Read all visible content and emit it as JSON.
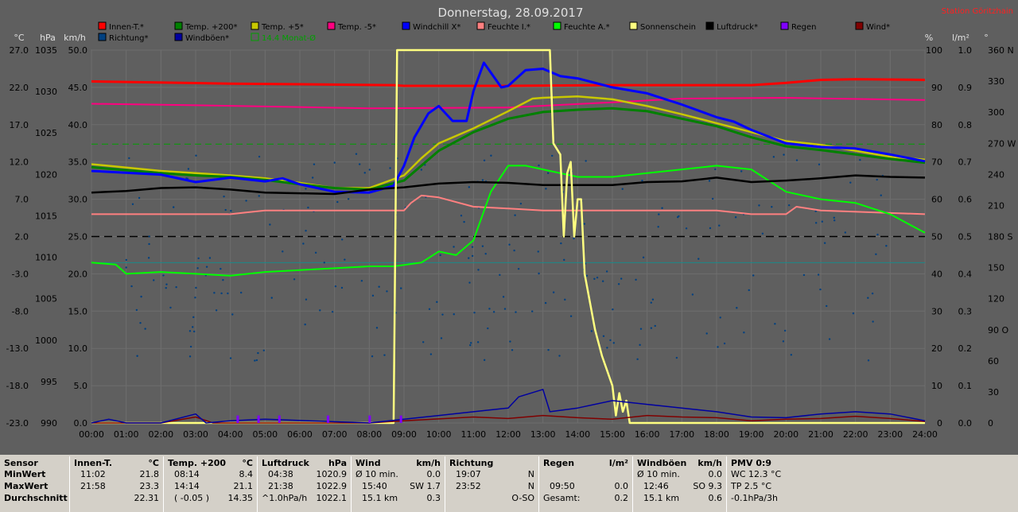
{
  "chart_data": {
    "type": "line",
    "title": "Donnerstag, 28.09.2017",
    "station": "Station Göritzhain",
    "background": "#5f5f5f",
    "grid": true,
    "x": {
      "range": [
        0,
        24
      ],
      "tick_labels": [
        "00:00",
        "01:00",
        "02:00",
        "03:00",
        "04:00",
        "05:00",
        "06:00",
        "07:00",
        "08:00",
        "09:00",
        "10:00",
        "11:00",
        "12:00",
        "13:00",
        "14:00",
        "15:00",
        "16:00",
        "17:00",
        "18:00",
        "19:00",
        "20:00",
        "21:00",
        "22:00",
        "23:00",
        "24:00"
      ]
    },
    "axes": {
      "temp_c": {
        "unit": "°C",
        "range": [
          -23,
          27
        ],
        "ticks": [
          "27.0",
          "22.0",
          "17.0",
          "12.0",
          "7.0",
          "2.0",
          "-3.0",
          "-8.0",
          "-13.0",
          "-18.0",
          "-23.0"
        ]
      },
      "pressure_hpa": {
        "unit": "hPa",
        "range": [
          990,
          1040
        ],
        "ticks": [
          "1035",
          "1030",
          "1025",
          "1020",
          "1015",
          "1010",
          "1005",
          "1000",
          "995",
          "990"
        ]
      },
      "wind_kmh": {
        "unit": "km/h",
        "range": [
          0,
          50
        ],
        "ticks": [
          "50.0",
          "45.0",
          "40.0",
          "35.0",
          "30.0",
          "25.0",
          "20.0",
          "15.0",
          "10.0",
          "5.0",
          "0.0"
        ]
      },
      "humidity_pct": {
        "unit": "%",
        "range": [
          0,
          100
        ],
        "ticks": [
          "100",
          "90",
          "80",
          "70",
          "60",
          "50",
          "40",
          "30",
          "20",
          "10",
          "0"
        ]
      },
      "rain_lm2": {
        "unit": "l/m²",
        "range": [
          0,
          1
        ],
        "ticks": [
          "1.0",
          "0.9",
          "0.8",
          "0.7",
          "0.6",
          "0.5",
          "0.4",
          "0.3",
          "0.2",
          "0.1",
          "0.0"
        ]
      },
      "direction_deg": {
        "unit": "°",
        "range": [
          0,
          360
        ],
        "ticks": [
          "360 N",
          "330",
          "300",
          "270 W",
          "240",
          "210",
          "180 S",
          "150",
          "120",
          "90 O",
          "60",
          "30",
          "0"
        ]
      }
    },
    "legend": [
      {
        "name": "Innen-T.*",
        "color": "#ff0000"
      },
      {
        "name": "Temp. +200*",
        "color": "#008000"
      },
      {
        "name": "Temp. +5*",
        "color": "#c8c800"
      },
      {
        "name": "Temp. -5*",
        "color": "#ff0080"
      },
      {
        "name": "Windchill X*",
        "color": "#0000ff"
      },
      {
        "name": "Feuchte I.*",
        "color": "#ff8080"
      },
      {
        "name": "Feuchte A.*",
        "color": "#00ff00"
      },
      {
        "name": "Sonnenschein",
        "color": "#ffff80"
      },
      {
        "name": "Luftdruck*",
        "color": "#000000"
      },
      {
        "name": "Regen",
        "color": "#8000ff"
      },
      {
        "name": "Wind*",
        "color": "#800000"
      },
      {
        "name": "Richtung*",
        "color": "#004080"
      },
      {
        "name": "Windböen*",
        "color": "#0000a0"
      },
      {
        "name": "14.4 Monat-Ø",
        "color": "#00a000"
      }
    ],
    "series": [
      {
        "name": "Innen-T.*",
        "axis": "temp_c",
        "color": "#ff0000",
        "x": [
          0,
          4,
          8.7,
          9,
          12,
          15,
          19,
          20,
          21,
          22,
          24
        ],
        "y": [
          22.8,
          22.5,
          22.3,
          22.2,
          22.2,
          22.3,
          22.3,
          22.6,
          23.0,
          23.1,
          23.0
        ]
      },
      {
        "name": "Temp. -5*",
        "color": "#ff0080",
        "axis": "temp_c",
        "x": [
          0,
          3,
          8,
          12,
          15,
          17,
          20,
          24
        ],
        "y": [
          19.8,
          19.6,
          19.2,
          19.3,
          20.0,
          20.5,
          20.6,
          20.3
        ]
      },
      {
        "name": "Temp. +5*",
        "color": "#c8c800",
        "axis": "temp_c",
        "x": [
          0,
          2,
          3,
          4,
          5,
          6,
          7,
          8,
          9,
          9.5,
          10,
          11,
          12,
          12.7,
          13,
          14,
          15,
          16,
          17,
          18,
          19,
          20,
          21,
          22,
          23,
          24
        ],
        "y": [
          11.7,
          10.8,
          10.5,
          10.2,
          9.8,
          9.2,
          8.5,
          8.5,
          10.2,
          12.5,
          14.5,
          16.5,
          18.8,
          20.5,
          20.6,
          20.8,
          20.4,
          19.5,
          18.4,
          17.2,
          16.0,
          14.8,
          14.3,
          13.5,
          12.7,
          12.3
        ]
      },
      {
        "name": "Temp. +200*",
        "color": "#008000",
        "axis": "temp_c",
        "x": [
          0,
          2,
          3,
          4,
          5,
          6,
          7,
          8,
          9,
          9.5,
          10,
          11,
          12,
          13,
          14,
          15,
          16,
          17,
          18,
          19,
          20,
          21,
          22,
          23,
          24
        ],
        "y": [
          11.3,
          10.5,
          10.2,
          10.0,
          9.6,
          9.0,
          8.5,
          8.3,
          9.5,
          11.5,
          13.5,
          16.0,
          17.8,
          18.7,
          19.0,
          19.2,
          18.8,
          17.8,
          16.8,
          15.3,
          14.1,
          13.6,
          13.0,
          12.4,
          11.9
        ]
      },
      {
        "name": "Windchill X*",
        "color": "#0000ff",
        "axis": "temp_c",
        "x": [
          0,
          2,
          3,
          4,
          5,
          5.5,
          6,
          7,
          8,
          8.7,
          9,
          9.3,
          9.7,
          10,
          10.4,
          10.8,
          11,
          11.3,
          11.8,
          12,
          12.5,
          13,
          13.5,
          14,
          15,
          16,
          17,
          18,
          18.5,
          19,
          20,
          21,
          22,
          23,
          24
        ],
        "y": [
          10.8,
          10.3,
          9.3,
          9.9,
          9.4,
          9.8,
          9.0,
          8.0,
          7.9,
          8.8,
          11.5,
          15.3,
          18.5,
          19.5,
          17.5,
          17.5,
          21.5,
          25.3,
          22.0,
          22.2,
          24.3,
          24.5,
          23.5,
          23.2,
          22.0,
          21.2,
          19.7,
          18.0,
          17.4,
          16.3,
          14.5,
          14.0,
          13.8,
          13.0,
          12.1
        ]
      },
      {
        "name": "Feuchte I.*",
        "color": "#ff8080",
        "axis": "humidity_pct",
        "x": [
          0,
          4,
          4.5,
          5,
          8,
          9,
          9.2,
          9.5,
          10,
          11,
          12,
          13,
          14,
          18,
          19,
          20,
          20.3,
          21,
          24
        ],
        "y": [
          56,
          56,
          56.5,
          57,
          57,
          57,
          59,
          61,
          60.5,
          58,
          57.5,
          57,
          57,
          57,
          56,
          56,
          58,
          57,
          56
        ]
      },
      {
        "name": "Feuchte A.*",
        "color": "#00ff00",
        "axis": "humidity_pct",
        "x": [
          0,
          0.7,
          1,
          2,
          3,
          4,
          5,
          6,
          7,
          8,
          8.7,
          9.5,
          10,
          10.5,
          11,
          11.5,
          12,
          12.5,
          13,
          14,
          15,
          16,
          17,
          18,
          19,
          20,
          21,
          22,
          23,
          24
        ],
        "y": [
          43,
          42.5,
          40,
          40.5,
          40,
          39.5,
          40.5,
          41,
          41.5,
          42,
          42,
          43,
          46,
          45,
          49,
          62,
          69,
          69,
          68,
          66,
          66,
          67,
          68,
          69,
          68,
          62,
          60,
          59,
          56,
          51
        ]
      },
      {
        "name": "Luftdruck*",
        "color": "#000000",
        "axis": "pressure_hpa",
        "x": [
          0,
          1,
          2,
          3,
          4,
          5,
          6,
          7,
          8,
          9,
          10,
          11,
          12,
          13,
          14,
          15,
          16,
          17,
          18,
          19,
          20,
          21,
          22,
          23,
          24
        ],
        "y": [
          1020.9,
          1021.1,
          1021.5,
          1021.6,
          1021.3,
          1020.9,
          1020.8,
          1020.7,
          1021.3,
          1021.6,
          1022.1,
          1022.3,
          1022.2,
          1021.9,
          1021.9,
          1021.9,
          1022.3,
          1022.4,
          1022.9,
          1022.3,
          1022.5,
          1022.8,
          1023.2,
          1023.0,
          1022.9
        ]
      },
      {
        "name": "Sonnenschein",
        "color": "#ffff80",
        "axis": "humidity_pct",
        "x": [
          0,
          8.7,
          8.75,
          8.8,
          13.2,
          13.3,
          13.5,
          13.6,
          13.7,
          13.8,
          13.9,
          14.0,
          14.1,
          14.2,
          14.5,
          14.7,
          15.0,
          15.1,
          15.2,
          15.3,
          15.4,
          15.5,
          24
        ],
        "y": [
          0,
          0,
          50,
          100,
          100,
          75,
          72,
          50,
          67,
          70,
          50,
          60,
          60,
          40,
          25,
          18,
          10,
          2,
          8,
          3,
          6,
          0,
          0
        ]
      },
      {
        "name": "Wind*",
        "color": "#800000",
        "axis": "wind_kmh",
        "x": [
          0,
          2,
          3,
          3.5,
          8,
          9,
          11,
          12,
          13,
          14,
          15,
          16,
          17,
          18,
          19,
          20,
          21,
          22,
          23,
          24
        ],
        "y": [
          0,
          0,
          0.8,
          0,
          0,
          0.3,
          0.8,
          0.6,
          1.0,
          0.7,
          0.5,
          1.0,
          0.8,
          0.7,
          0.3,
          0.5,
          0.6,
          0.9,
          0.6,
          0.2
        ]
      },
      {
        "name": "Windböen*",
        "color": "#0000a0",
        "axis": "wind_kmh",
        "x": [
          0,
          0.5,
          1,
          2,
          3,
          3.3,
          4,
          5,
          8,
          9,
          10,
          11,
          12,
          12.3,
          13,
          13.2,
          14,
          15,
          16,
          17,
          18,
          19,
          20,
          21,
          22,
          23,
          24
        ],
        "y": [
          0,
          0.5,
          0,
          0,
          1.2,
          0,
          0.3,
          0.5,
          0,
          0.5,
          1.0,
          1.5,
          2.0,
          3.5,
          4.5,
          1.5,
          2.0,
          3.0,
          2.5,
          2.0,
          1.5,
          0.8,
          0.7,
          1.2,
          1.5,
          1.2,
          0.3
        ]
      },
      {
        "name": "Regen",
        "color": "#8000ff",
        "axis": "rain_lm2",
        "x": [
          4.2,
          4.8,
          5.4,
          6.8,
          8.0,
          8.9
        ],
        "y": [
          0.02,
          0.02,
          0.02,
          0.02,
          0.02,
          0.02
        ]
      }
    ],
    "reference_lines": [
      {
        "name": "14.4 Monat-Ø",
        "axis": "temp_c",
        "value": 14.4,
        "color": "#00a000"
      }
    ],
    "direction_scatter": {
      "name": "Richtung*",
      "axis": "direction_deg",
      "color": "#004080",
      "note": "scattered dots"
    }
  },
  "stats": {
    "sensor": {
      "header": "Sensor",
      "rows": [
        "MinWert",
        "MaxWert",
        "Durchschnitt"
      ]
    },
    "innen": {
      "header": "Innen-T.",
      "unit": "°C",
      "rows": [
        [
          "11:02",
          "21.8"
        ],
        [
          "21:58",
          "23.3"
        ],
        [
          "",
          "22.31"
        ]
      ]
    },
    "temp": {
      "header": "Temp. +200",
      "unit": "°C",
      "rows": [
        [
          "08:14",
          "8.4"
        ],
        [
          "14:14",
          "21.1"
        ],
        [
          "( -0.05 )",
          "14.35"
        ]
      ]
    },
    "druck": {
      "header": "Luftdruck",
      "unit": "hPa",
      "rows": [
        [
          "04:38",
          "1020.9"
        ],
        [
          "21:38",
          "1022.9"
        ],
        [
          "^1.0hPa/h",
          "1022.1"
        ]
      ]
    },
    "wind": {
      "header": "Wind",
      "unit": "km/h",
      "rows": [
        [
          "Ø 10 min.",
          "0.0"
        ],
        [
          "15:40",
          "SW 1.7"
        ],
        [
          "15.1 km",
          "0.3"
        ]
      ]
    },
    "richtung": {
      "header": "Richtung",
      "unit": "",
      "rows": [
        [
          "19:07",
          "N"
        ],
        [
          "23:52",
          "N"
        ],
        [
          "",
          "O-SO"
        ]
      ]
    },
    "regen": {
      "header": "Regen",
      "unit": "l/m²",
      "rows": [
        [
          "",
          ""
        ],
        [
          "09:50",
          "0.0"
        ],
        [
          "Gesamt:",
          "0.2"
        ]
      ]
    },
    "boeen": {
      "header": "Windböen",
      "unit": "km/h",
      "rows": [
        [
          "Ø 10 min.",
          "0.0"
        ],
        [
          "12:46",
          "SO 9.3"
        ],
        [
          "15.1 km",
          "0.6"
        ]
      ]
    },
    "pmv": {
      "header": "PMV 0:9",
      "rows": [
        "WC 12.3 °C",
        "TP 2.5 °C",
        "-0.1hPa/3h"
      ]
    }
  }
}
